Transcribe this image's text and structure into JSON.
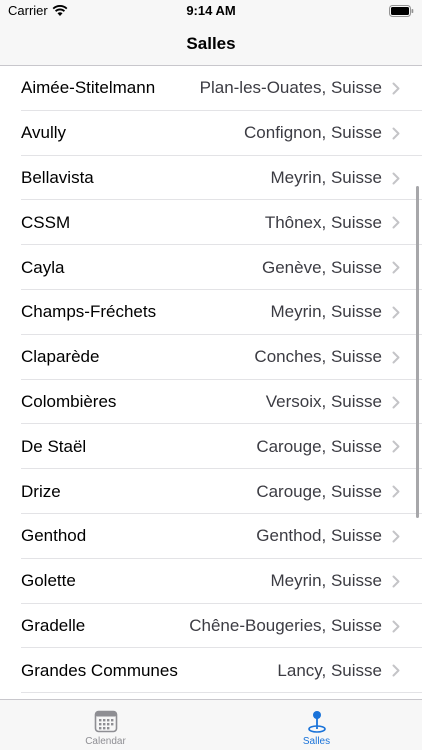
{
  "status_bar": {
    "carrier": "Carrier",
    "time": "9:14 AM"
  },
  "nav": {
    "title": "Salles"
  },
  "rows": [
    {
      "name": "Aimée-Stitelmann",
      "place": "Plan-les-Ouates, Suisse"
    },
    {
      "name": "Avully",
      "place": "Confignon, Suisse"
    },
    {
      "name": "Bellavista",
      "place": "Meyrin, Suisse"
    },
    {
      "name": "CSSM",
      "place": "Thônex, Suisse"
    },
    {
      "name": "Cayla",
      "place": "Genève, Suisse"
    },
    {
      "name": "Champs-Fréchets",
      "place": "Meyrin, Suisse"
    },
    {
      "name": "Claparède",
      "place": "Conches, Suisse"
    },
    {
      "name": "Colombières",
      "place": "Versoix, Suisse"
    },
    {
      "name": "De Staël",
      "place": "Carouge, Suisse"
    },
    {
      "name": "Drize",
      "place": "Carouge, Suisse"
    },
    {
      "name": "Genthod",
      "place": "Genthod, Suisse"
    },
    {
      "name": "Golette",
      "place": "Meyrin, Suisse"
    },
    {
      "name": "Gradelle",
      "place": "Chêne-Bougeries, Suisse"
    },
    {
      "name": "Grandes Communes",
      "place": "Lancy, Suisse"
    }
  ],
  "tabs": [
    {
      "label": "Calendar",
      "icon": "calendar-icon",
      "selected": false
    },
    {
      "label": "Salles",
      "icon": "map-pin-icon",
      "selected": true
    }
  ],
  "colors": {
    "accent": "#1a73d9",
    "inactive": "#8e8e93",
    "bar_bg": "#f7f7f7"
  }
}
